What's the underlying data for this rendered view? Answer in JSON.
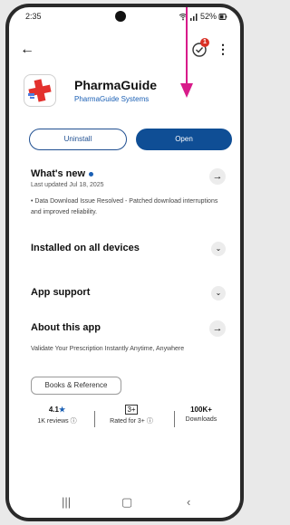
{
  "status": {
    "time": "2:35",
    "battery": "52%"
  },
  "topbar": {
    "updates_badge": "1"
  },
  "app": {
    "title": "PharmaGuide",
    "developer": "PharmaGuide Systems"
  },
  "buttons": {
    "uninstall": "Uninstall",
    "open": "Open"
  },
  "whats_new": {
    "title": "What's new",
    "updated": "Last updated Jul 18, 2025",
    "text": "• Data Download Issue Resolved - Patched download interruptions and improved reliability."
  },
  "sections": {
    "installed": "Installed on all devices",
    "support": "App support",
    "about": "About this app"
  },
  "about": {
    "text": "Validate Your Prescription Instantly Anytime, Anywhere"
  },
  "category": "Books & Reference",
  "stats": {
    "rating": "4.1",
    "reviews": "1K reviews",
    "rated_value": "3+",
    "rated_label": "Rated for 3+",
    "downloads": "100K+",
    "downloads_label": "Downloads"
  },
  "colors": {
    "accent": "#0f4e95",
    "brand": "#1a5fb4",
    "pink": "#d81b8a",
    "badge": "#d93025"
  }
}
